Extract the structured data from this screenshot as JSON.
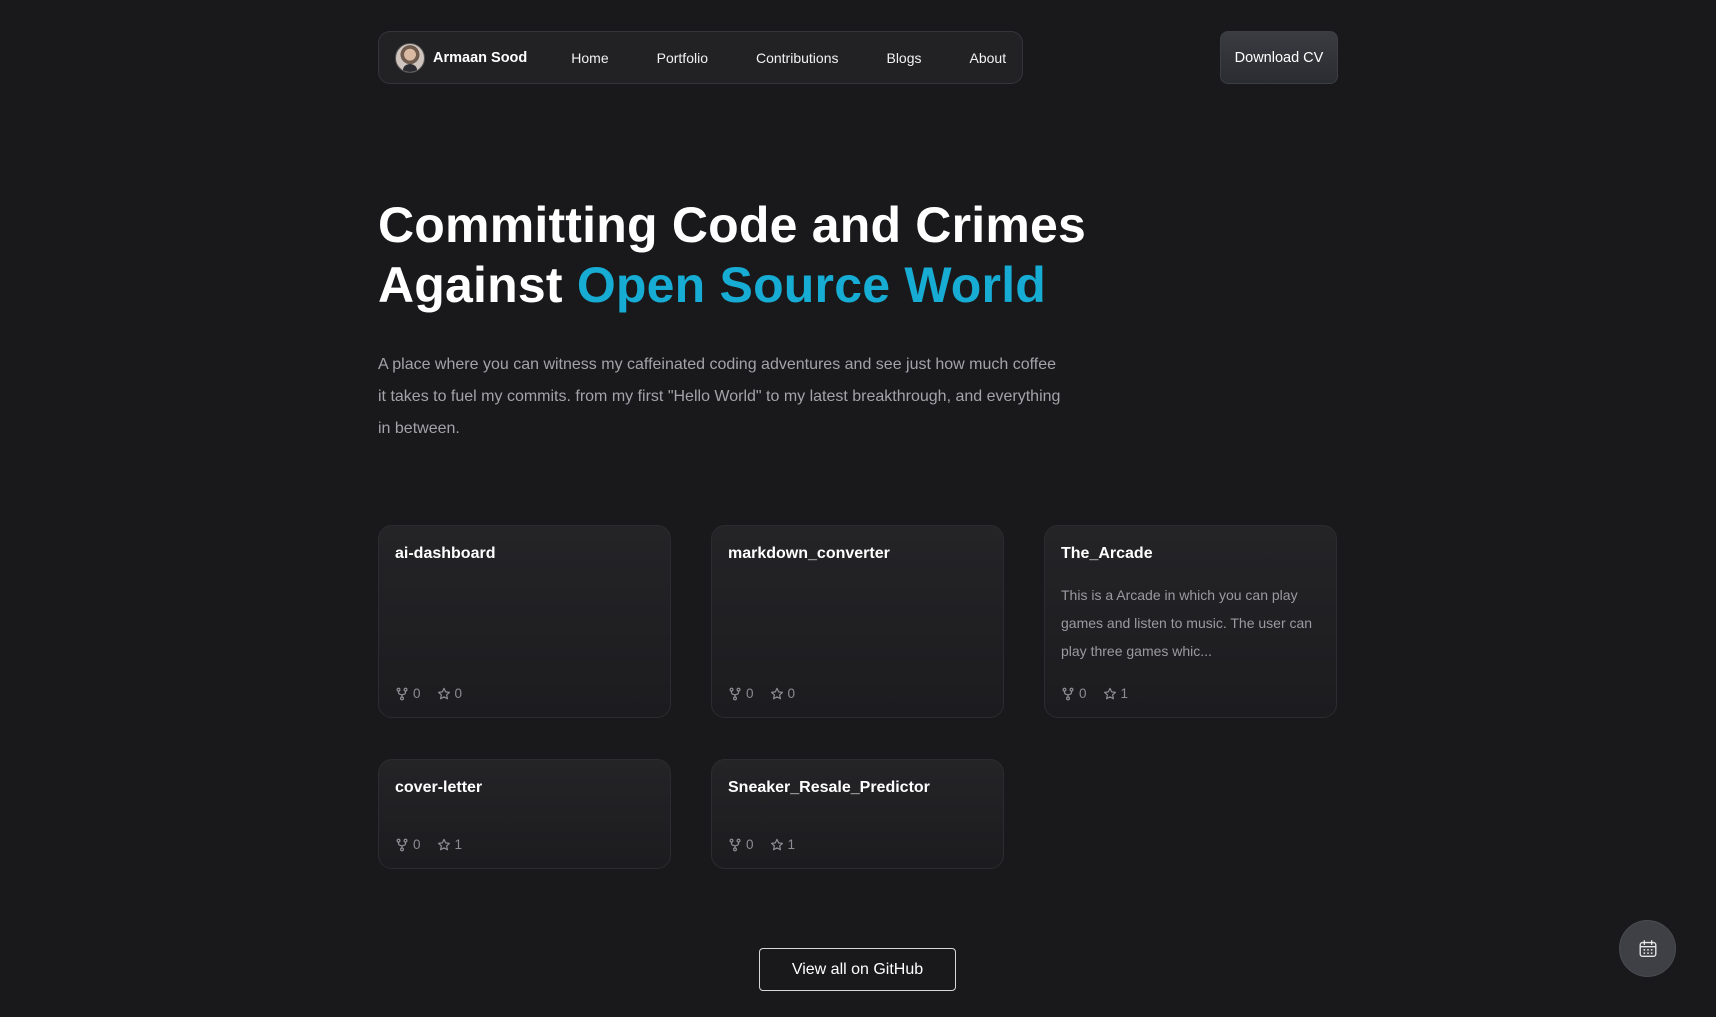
{
  "nav": {
    "brand_name": "Armaan Sood",
    "links": [
      "Home",
      "Portfolio",
      "Contributions",
      "Blogs",
      "About"
    ],
    "cta_label": "Download CV"
  },
  "hero": {
    "title_line1": "Committing Code and Crimes",
    "title_line2_prefix": "Against",
    "title_line2_accent": "Open Source World",
    "accent_color": "#16acd3",
    "description": "A place where you can witness my caffeinated coding adventures and see just how much coffee it takes to fuel my commits. from my first \"Hello World\" to my latest breakthrough, and everything in between."
  },
  "repos": [
    {
      "name": "ai-dashboard",
      "description": "",
      "forks": "0",
      "stars": "0"
    },
    {
      "name": "markdown_converter",
      "description": "",
      "forks": "0",
      "stars": "0"
    },
    {
      "name": "The_Arcade",
      "description": "This is a Arcade in which you can play games and listen to music. The user can play three games whic...",
      "forks": "0",
      "stars": "1"
    },
    {
      "name": "cover-letter",
      "description": "",
      "forks": "0",
      "stars": "1"
    },
    {
      "name": "Sneaker_Resale_Predictor",
      "description": "",
      "forks": "0",
      "stars": "1"
    }
  ],
  "github_button_label": "View all on GitHub",
  "icons": {
    "fork": "fork-icon",
    "star": "star-icon",
    "calendar": "calendar-icon"
  }
}
